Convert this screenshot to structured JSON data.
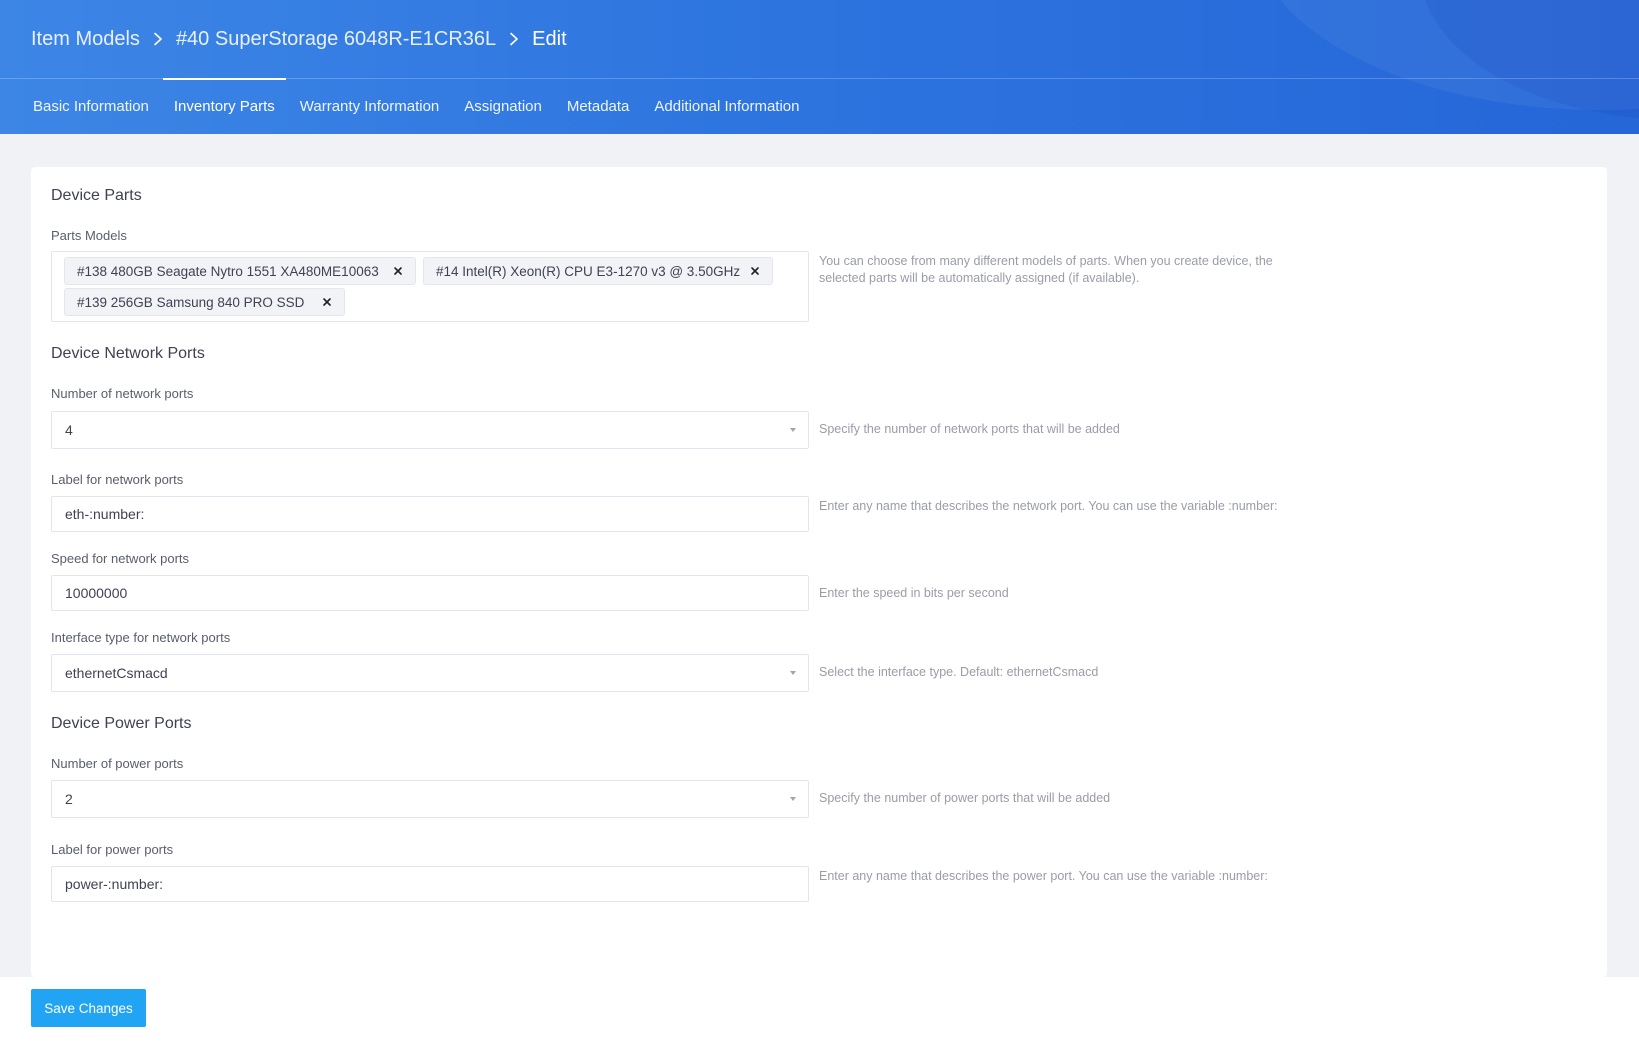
{
  "breadcrumb": {
    "items": [
      "Item Models",
      "#40 SuperStorage 6048R-E1CR36L",
      "Edit"
    ]
  },
  "tabs": [
    {
      "label": "Basic Information",
      "active": false
    },
    {
      "label": "Inventory Parts",
      "active": true
    },
    {
      "label": "Warranty Information",
      "active": false
    },
    {
      "label": "Assignation",
      "active": false
    },
    {
      "label": "Metadata",
      "active": false
    },
    {
      "label": "Additional Information",
      "active": false
    }
  ],
  "device_parts": {
    "title": "Device Parts",
    "parts_models": {
      "label": "Parts Models",
      "tags": [
        "#138 480GB Seagate Nytro 1551 XA480ME10063",
        "#14 Intel(R) Xeon(R) CPU E3-1270 v3 @ 3.50GHz",
        "#139 256GB Samsung 840 PRO SSD"
      ],
      "help": "You can choose from many different models of parts. When you create device, the selected parts will be automatically assigned (if available)."
    }
  },
  "network_ports": {
    "title": "Device Network Ports",
    "number": {
      "label": "Number of network ports",
      "value": "4",
      "help": "Specify the number of network ports that will be added"
    },
    "label_field": {
      "label": "Label for network ports",
      "value": "eth-:number:",
      "help": "Enter any name that describes the network port. You can use the variable :number:"
    },
    "speed": {
      "label": "Speed for network ports",
      "value": "10000000",
      "help": "Enter the speed in bits per second"
    },
    "interface": {
      "label": "Interface type for network ports",
      "value": "ethernetCsmacd",
      "help": "Select the interface type. Default: ethernetCsmacd"
    }
  },
  "power_ports": {
    "title": "Device Power Ports",
    "number": {
      "label": "Number of power ports",
      "value": "2",
      "help": "Specify the number of power ports that will be added"
    },
    "label_field": {
      "label": "Label for power ports",
      "value": "power-:number:",
      "help": "Enter any name that describes the power port. You can use the variable :number:"
    }
  },
  "footer": {
    "save_label": "Save Changes"
  },
  "colors": {
    "header_blue": "#2e75df",
    "save_button": "#22a4f5"
  },
  "icons": [
    "chevron-right-icon",
    "close-icon",
    "dropdown-caret-icon"
  ]
}
